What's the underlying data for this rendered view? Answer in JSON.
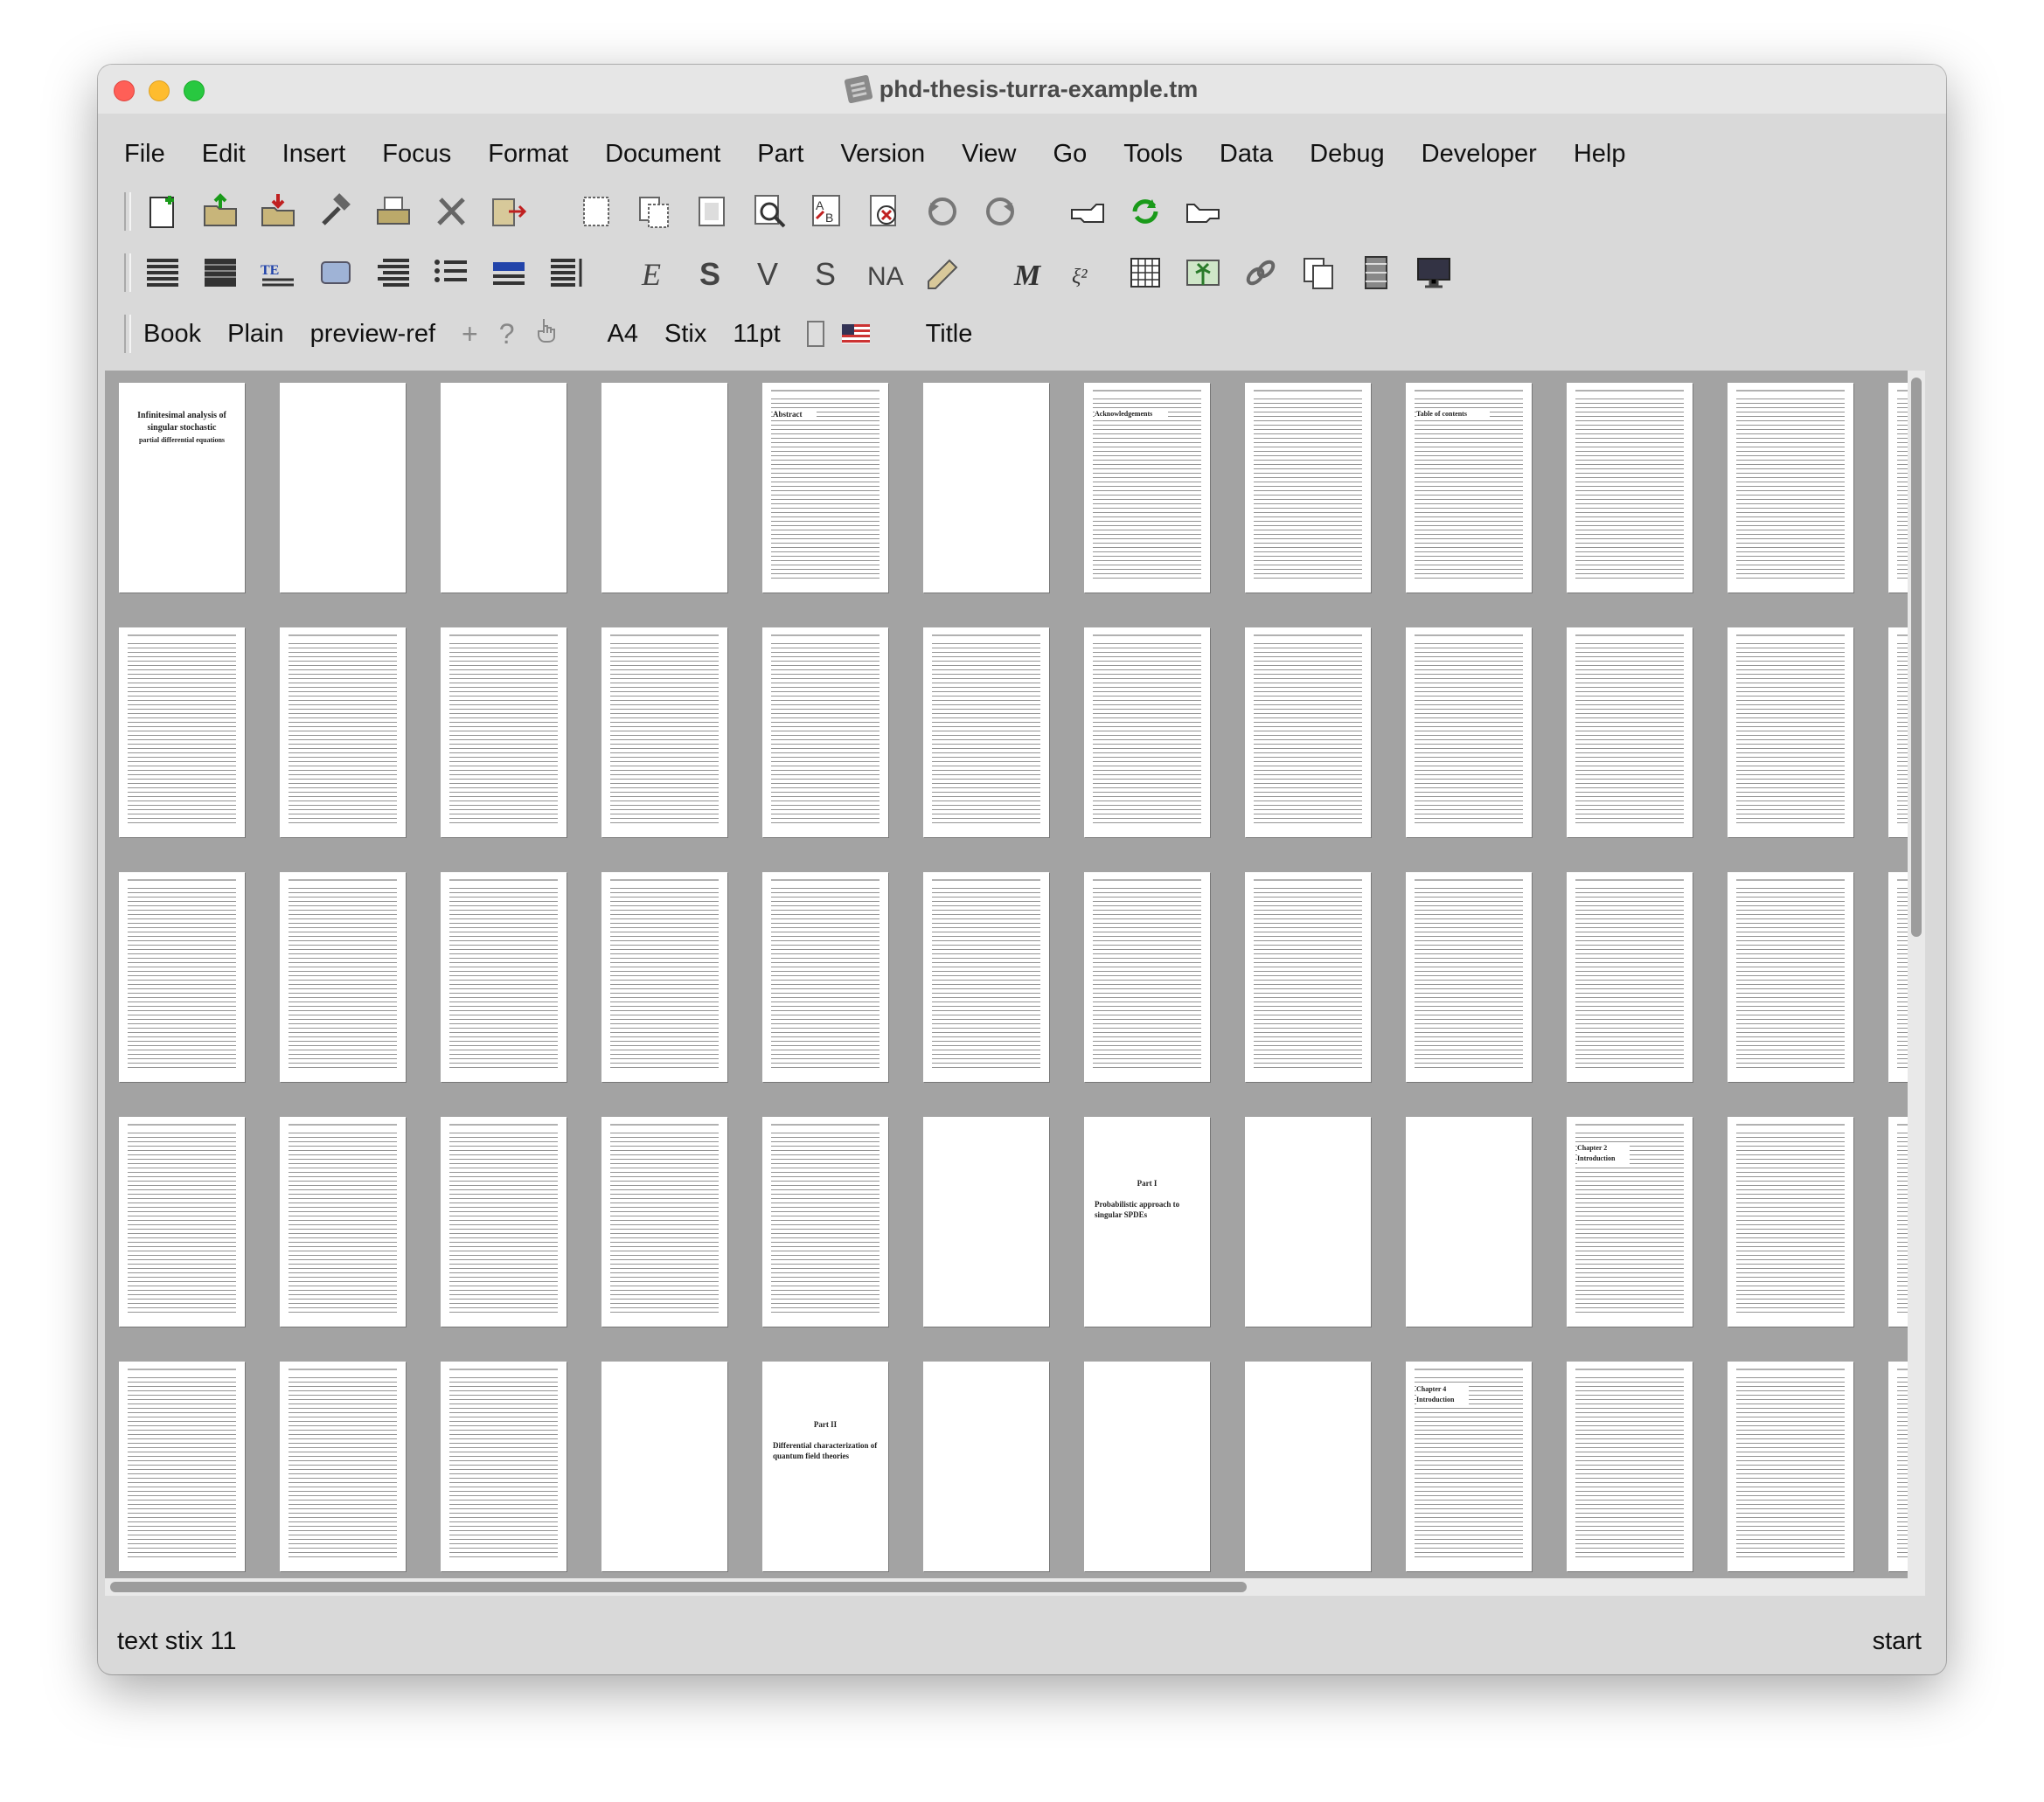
{
  "window": {
    "title": "phd-thesis-turra-example.tm"
  },
  "menu": [
    "File",
    "Edit",
    "Insert",
    "Focus",
    "Format",
    "Document",
    "Part",
    "Version",
    "View",
    "Go",
    "Tools",
    "Data",
    "Debug",
    "Developer",
    "Help"
  ],
  "format_bar": {
    "style": "Book",
    "variant": "Plain",
    "extra": "preview-ref",
    "plus": "+",
    "question": "?",
    "paper": "A4",
    "font": "Stix",
    "size": "11pt",
    "tag": "Title"
  },
  "pages": {
    "title_page": [
      "Infinitesimal analysis of",
      "singular stochastic",
      "partial differential equations"
    ],
    "part1_label": "Part I",
    "part1_title": "Probabilistic approach to singular SPDEs",
    "part2_label": "Part II",
    "part2_title": "Differential characterization of quantum field theories",
    "abstract_heading": "Abstract",
    "ack_heading": "Acknowledgements",
    "toc_heading": "Table of contents",
    "chapter2_heading": "Chapter 2",
    "chapter2_sub": "Introduction",
    "chapter4_heading": "Chapter 4",
    "chapter4_sub": "Introduction"
  },
  "status": {
    "left": "text stix 11",
    "right": "start"
  }
}
